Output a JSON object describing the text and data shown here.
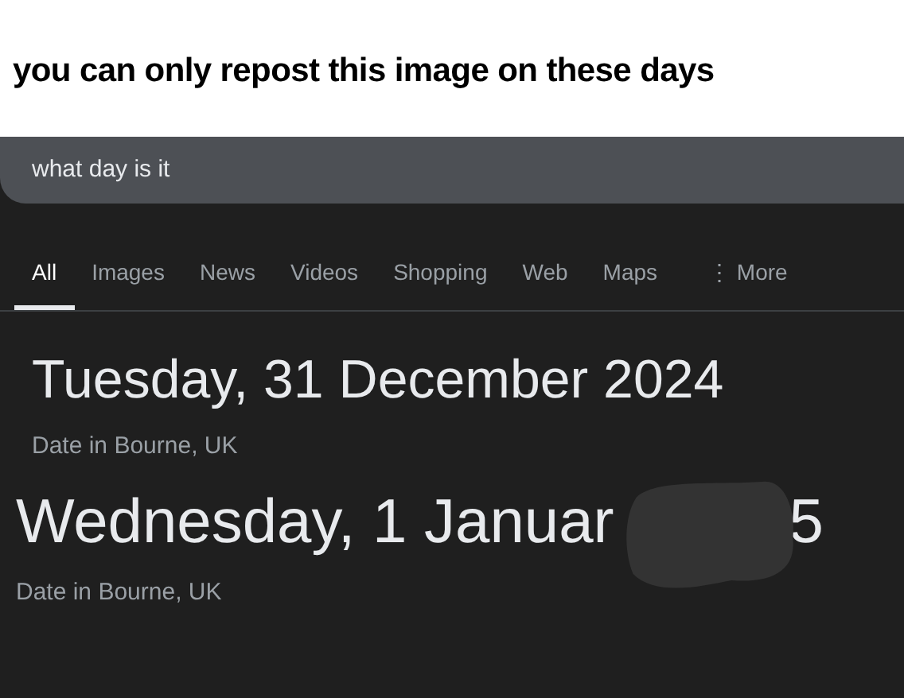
{
  "caption": "you can only repost this image on these days",
  "search": {
    "value": "what day is it"
  },
  "tabs": [
    {
      "label": "All",
      "selected": true
    },
    {
      "label": "Images",
      "selected": false
    },
    {
      "label": "News",
      "selected": false
    },
    {
      "label": "Videos",
      "selected": false
    },
    {
      "label": "Shopping",
      "selected": false
    },
    {
      "label": "Web",
      "selected": false
    },
    {
      "label": "Maps",
      "selected": false
    },
    {
      "label": "⋮ More",
      "selected": false
    }
  ],
  "results": [
    {
      "date": "Tuesday, 31 December 2024",
      "location": "Date in Bourne, UK",
      "covered": false
    },
    {
      "date": "Wednesday, 1 Januar",
      "tail": "5",
      "location": "Date in Bourne, UK",
      "covered": true
    }
  ]
}
